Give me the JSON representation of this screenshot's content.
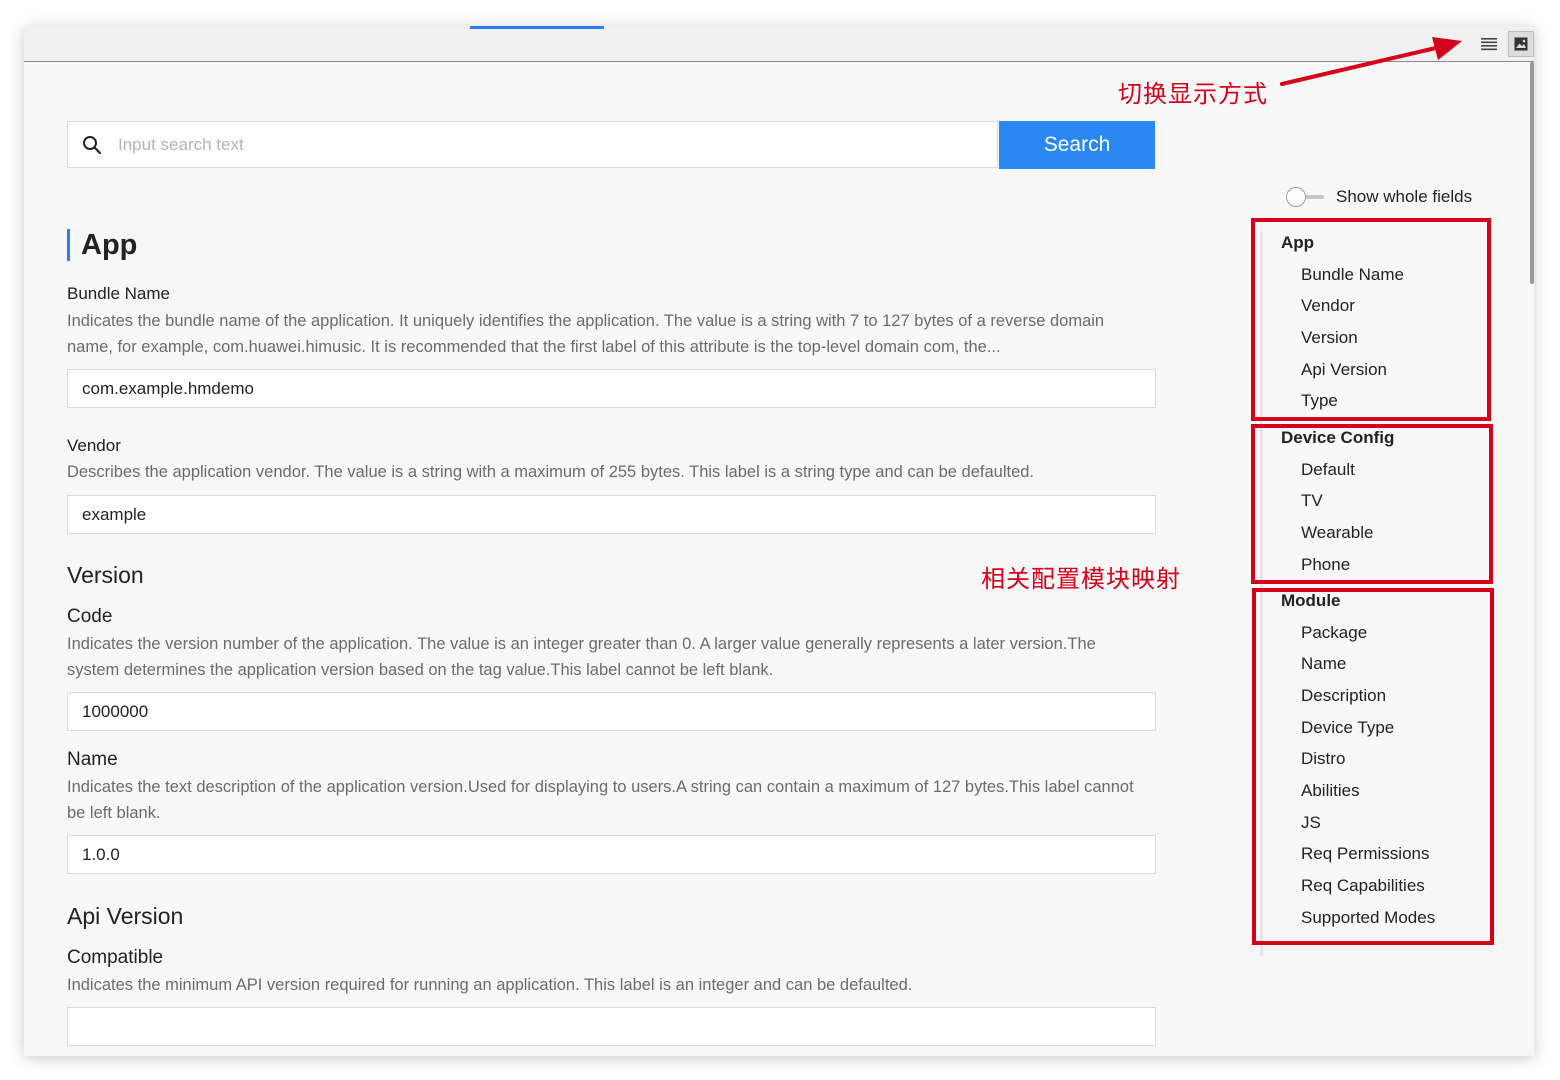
{
  "toolbar": {
    "list_view_icon": "list-icon",
    "image_view_icon": "image-icon"
  },
  "search": {
    "placeholder": "Input search text",
    "value": "",
    "button_label": "Search"
  },
  "toggle": {
    "label": "Show whole fields",
    "on": false
  },
  "main": {
    "section_title": "App",
    "fields": {
      "bundle_name": {
        "label": "Bundle Name",
        "description": "Indicates the bundle name of the application. It uniquely identifies the application. The value is a string with 7 to 127 bytes of a reverse domain name, for example, com.huawei.himusic. It is recommended that the first label of this attribute is the top-level domain com, the...",
        "value": "com.example.hmdemo"
      },
      "vendor": {
        "label": "Vendor",
        "description": "Describes the application vendor. The value is a string with a maximum of 255 bytes. This label is a string type and can be defaulted.",
        "value": "example"
      },
      "version_title": "Version",
      "code": {
        "label": "Code",
        "description": "Indicates the version number of the application. The value is an integer greater than 0. A larger value generally represents a later version.The system determines the application version based on the tag value.This label cannot be left blank.",
        "value": "1000000"
      },
      "name": {
        "label": "Name",
        "description": "Indicates the text description of the application version.Used for displaying to users.A string can contain a maximum of 127 bytes.This label cannot be left blank.",
        "value": "1.0.0"
      },
      "api_version_title": "Api Version",
      "compatible": {
        "label": "Compatible",
        "description": "Indicates the minimum API version required for running an application. This label is an integer and can be defaulted.",
        "value": ""
      }
    }
  },
  "nav": {
    "groups": [
      {
        "title": "App",
        "items": [
          "Bundle Name",
          "Vendor",
          "Version",
          "Api Version",
          "Type"
        ]
      },
      {
        "title": "Device Config",
        "items": [
          "Default",
          "TV",
          "Wearable",
          "Phone"
        ]
      },
      {
        "title": "Module",
        "items": [
          "Package",
          "Name",
          "Description",
          "Device Type",
          "Distro",
          "Abilities",
          "JS",
          "Req Permissions",
          "Req Capabilities",
          "Supported Modes"
        ]
      }
    ]
  },
  "annotations": {
    "switch_display": "切换显示方式",
    "module_mapping": "相关配置模块映射"
  },
  "colors": {
    "accent": "#2b87f3",
    "annotation_red": "#d7001b",
    "window_bg": "#f7f7f7"
  }
}
